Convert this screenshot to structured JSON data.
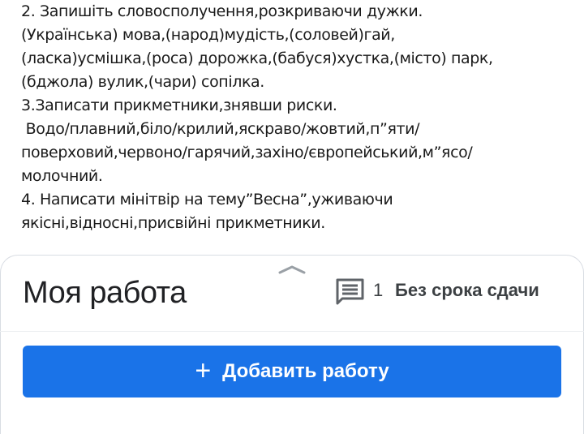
{
  "assignment": {
    "lines": [
      "2. Запишіть словосполучення,розкриваючи дужки.",
      "(Українська) мова,(народ)мудість,(соловей)гай,",
      "(ласка)усмішка,(роса) дорожка,(бабуся)хустка,(місто) парк,",
      "(бджола) вулик,(чари) сопілка.",
      "3.Записати прикметники,знявши риски.",
      " Водо/плавний,біло/крилий,яскраво/жовтий,п”яти/",
      "поверховий,червоно/гарячий,захіно/європейський,м”ясо/",
      "молочний.",
      "4. Написати мінітвір на тему”Весна”,уживаючи",
      "якісні,відносні,присвійні прикметники."
    ]
  },
  "work_panel": {
    "title": "Моя работа",
    "comment_icon": "comment-icon",
    "comment_count": "1",
    "due": "Без срока сдачи",
    "add_button": {
      "icon": "plus-icon",
      "label": "Добавить работу"
    }
  },
  "colors": {
    "accent": "#1a73e8",
    "text": "#202124",
    "secondary": "#3c4043"
  }
}
